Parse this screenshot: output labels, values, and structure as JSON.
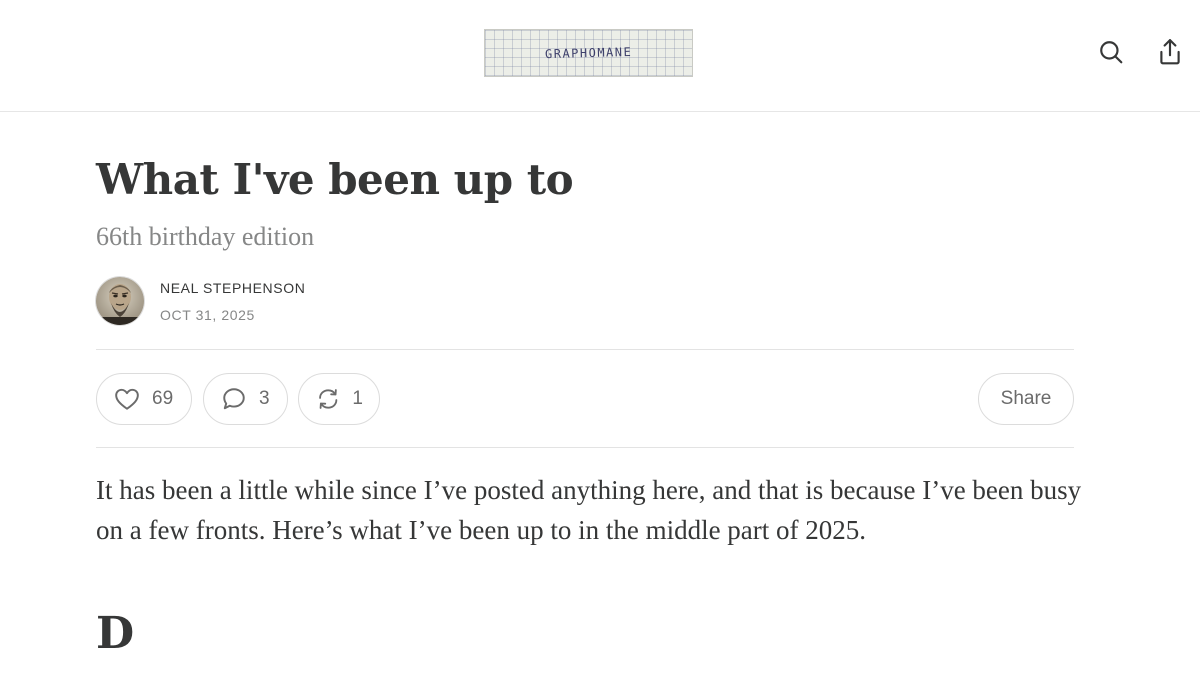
{
  "header": {
    "logo_text": "GRAPHOMANE",
    "search_icon": "search-icon",
    "share_icon": "share-upload-icon"
  },
  "post": {
    "title": "What I've been up to",
    "subtitle": "66th birthday edition",
    "author": "NEAL STEPHENSON",
    "date": "OCT 31, 2025"
  },
  "actions": {
    "likes": "69",
    "comments": "3",
    "restacks": "1",
    "share_label": "Share",
    "icons": [
      "heart-icon",
      "comment-icon",
      "restack-icon"
    ]
  },
  "body": {
    "intro": "It has been a little while since I’ve posted anything here, and that is because I’ve been busy on a few fronts. Here’s what I’ve been up to in the middle part of 2025.",
    "section_heading": "D"
  },
  "colors": {
    "text": "#363737",
    "muted": "#868787",
    "border": "#dcdcdc"
  }
}
